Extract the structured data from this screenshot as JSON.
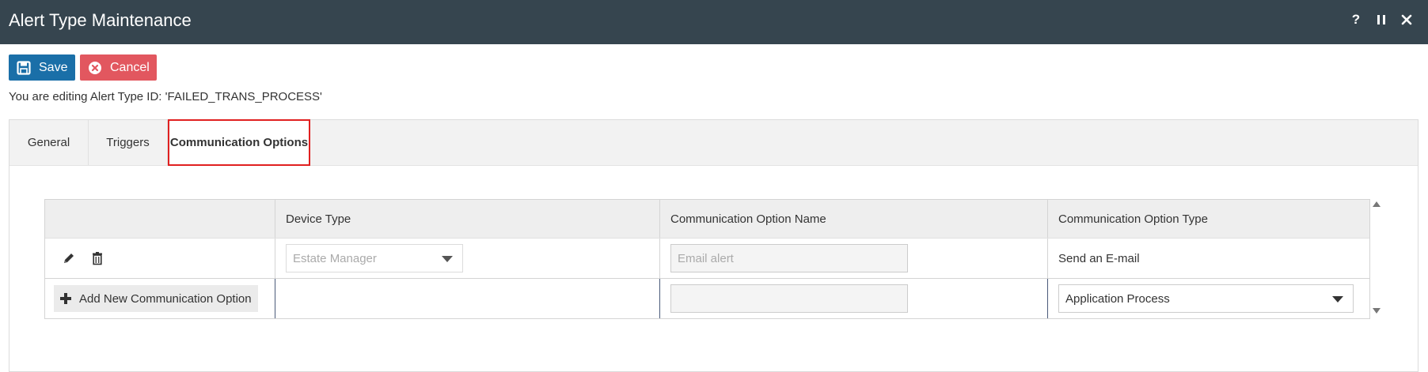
{
  "window": {
    "title": "Alert Type Maintenance",
    "help_label": "?",
    "pause_label": "II",
    "close_label": "✕"
  },
  "toolbar": {
    "save_label": "Save",
    "cancel_label": "Cancel",
    "save_icon": "floppy-disk-icon",
    "cancel_icon": "cancel-circle-icon"
  },
  "editing_message": "You are editing Alert Type ID: 'FAILED_TRANS_PROCESS'",
  "tabs": [
    {
      "label": "General",
      "selected": false
    },
    {
      "label": "Triggers",
      "selected": false
    },
    {
      "label": "Communication Options",
      "selected": true
    }
  ],
  "grid": {
    "columns": [
      "",
      "Device Type",
      "Communication Option Name",
      "Communication Option Type"
    ],
    "rows": [
      {
        "device_type": "Estate Manager",
        "option_name": "Email alert",
        "option_type": "Send an E-mail"
      }
    ],
    "new_row": {
      "add_label": "Add New Communication Option",
      "option_name": "",
      "option_type": "Application Process"
    }
  },
  "colors": {
    "titlebar": "#36454f",
    "save": "#1a6fa8",
    "cancel": "#e2575f",
    "tab_highlight": "#e02020"
  }
}
